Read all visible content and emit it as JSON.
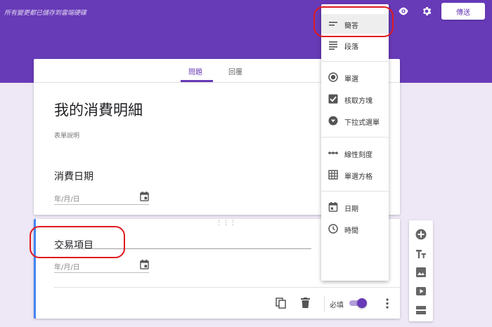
{
  "header": {
    "saved_message": "所有變更都已儲存到雲端硬碟",
    "send_label": "傳送",
    "colors": {
      "primary": "#673ab7",
      "background": "#ede7f6",
      "accent_border": "#4285f4",
      "annotation": "#e0191f"
    },
    "icons": [
      "eye-icon",
      "gear-icon"
    ]
  },
  "tabs": [
    {
      "label": "問題",
      "active": true
    },
    {
      "label": "回覆",
      "active": false
    }
  ],
  "form": {
    "title": "我的消費明細",
    "description_placeholder": "表單說明"
  },
  "questions": [
    {
      "title": "消費日期",
      "date_placeholder": "年/月/日"
    },
    {
      "title": "交易項目",
      "date_placeholder": "年/月/日"
    }
  ],
  "question_footer": {
    "required_label": "必填",
    "required": true
  },
  "type_menu": {
    "items": [
      {
        "label": "簡答",
        "icon": "short-answer-icon",
        "selected": true
      },
      {
        "label": "段落",
        "icon": "paragraph-icon",
        "selected": false
      },
      {
        "label": "單選",
        "icon": "radio-icon",
        "selected": false
      },
      {
        "label": "核取方塊",
        "icon": "checkbox-icon",
        "selected": false
      },
      {
        "label": "下拉式選單",
        "icon": "dropdown-icon",
        "selected": false
      },
      {
        "label": "線性刻度",
        "icon": "linear-scale-icon",
        "selected": false
      },
      {
        "label": "單選方格",
        "icon": "grid-icon",
        "selected": false
      },
      {
        "label": "日期",
        "icon": "date-icon",
        "selected": false
      },
      {
        "label": "時間",
        "icon": "time-icon",
        "selected": false
      }
    ]
  },
  "side_toolbar": {
    "icons": [
      "add-question-icon",
      "add-title-icon",
      "add-image-icon",
      "add-video-icon",
      "add-section-icon"
    ]
  }
}
